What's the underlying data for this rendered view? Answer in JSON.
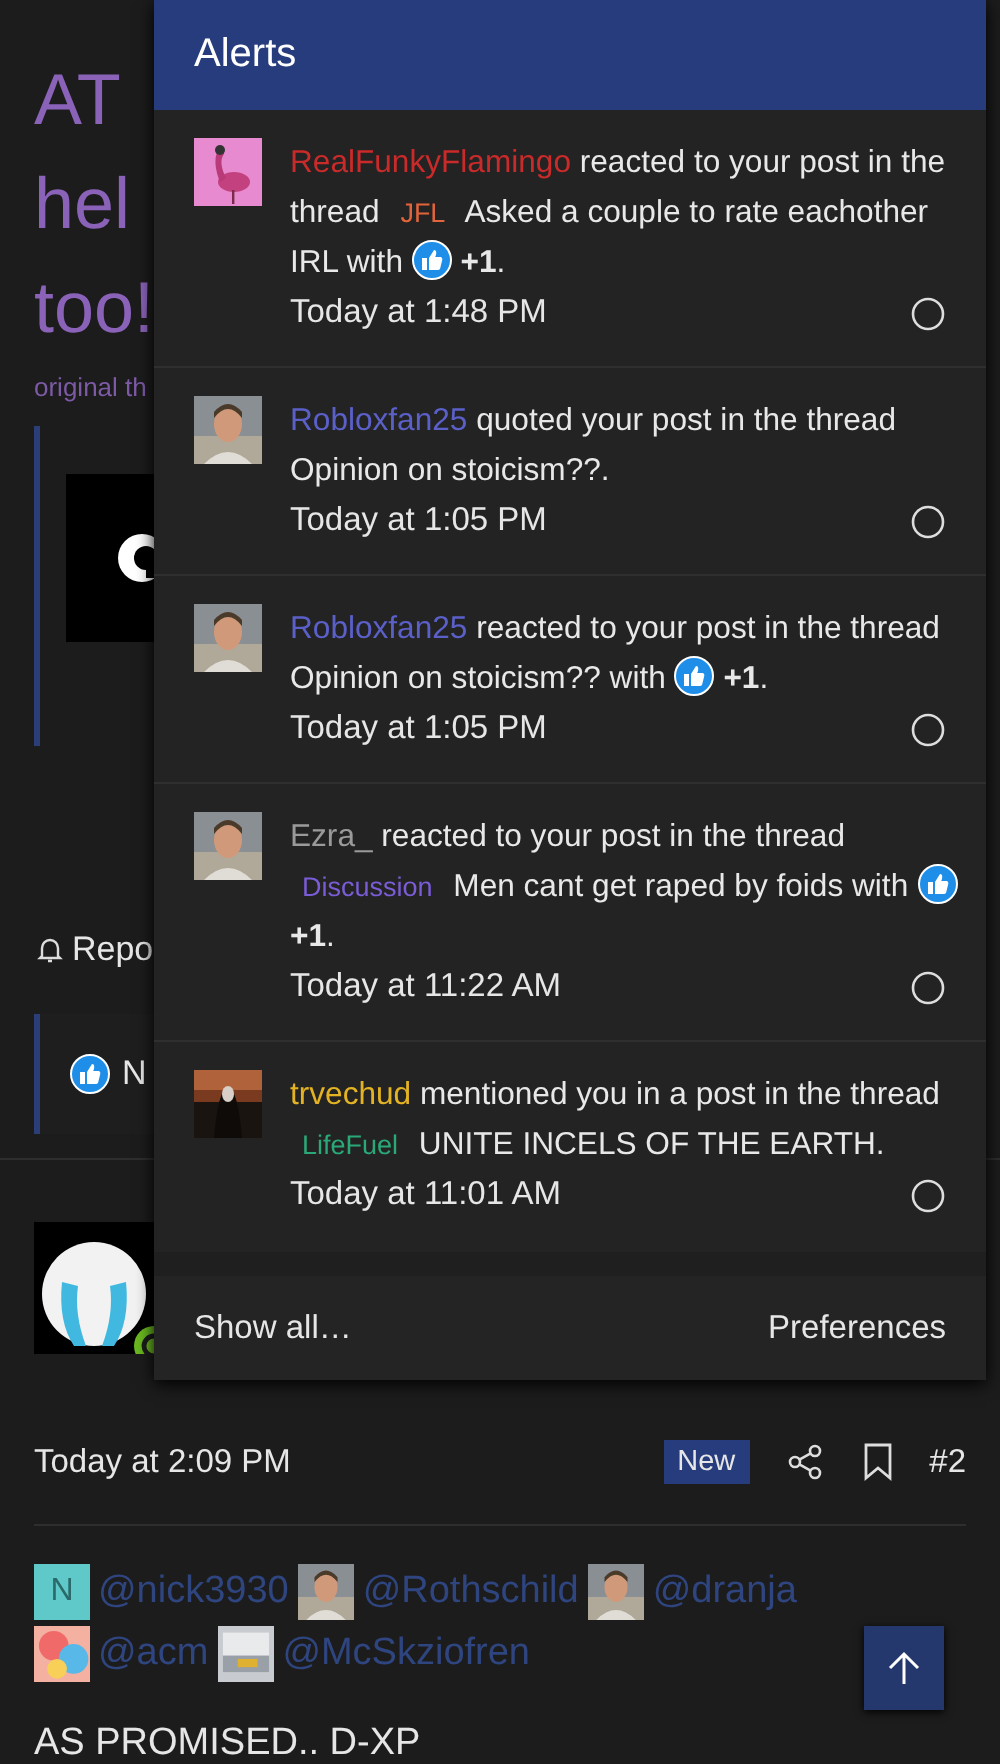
{
  "background_thread": {
    "title_lines": [
      "AT",
      "hel",
      "too!"
    ],
    "source": "original th",
    "report": "Repo",
    "reaction_bar": "N"
  },
  "alerts": {
    "title": "Alerts",
    "items": [
      {
        "user": {
          "name": "RealFunkyFlamingo",
          "color": "#c92a2a"
        },
        "avatar": {
          "kind": "flamingo"
        },
        "action": "reacted to your post in the thread",
        "prefix": {
          "label": "JFL",
          "color": "#e0643c"
        },
        "title": "Asked a couple to rate eachother IRL",
        "reaction": "with",
        "reaction_count": "**+1**.",
        "time": "Today at 1:48 PM",
        "read": false
      },
      {
        "user": {
          "name": "Robloxfan25",
          "color": "#5b60c9"
        },
        "avatar": {
          "kind": "person"
        },
        "action": "quoted your post in the thread",
        "title": "Opinion on stoicism??.",
        "time": "Today at 1:05 PM",
        "read": false
      },
      {
        "user": {
          "name": "Robloxfan25",
          "color": "#5b60c9"
        },
        "avatar": {
          "kind": "person"
        },
        "action": "reacted to your post in the thread",
        "title": "Opinion on stoicism??",
        "reaction": "with",
        "reaction_count": "**+1**.",
        "time": "Today at 1:05 PM",
        "read": false
      },
      {
        "user": {
          "name": "Ezra_",
          "color": "#9a9a9a"
        },
        "avatar": {
          "kind": "person"
        },
        "action": "reacted to your post in the thread",
        "prefix": {
          "label": "Discussion",
          "color": "#7a5cd6"
        },
        "title": "Men cant get raped by foids",
        "reaction": "with",
        "reaction_count": "**+1**.",
        "time": "Today at 11:22 AM",
        "read": false
      },
      {
        "user": {
          "name": "trvechud",
          "color": "#e3b324"
        },
        "avatar": {
          "kind": "dark"
        },
        "action": "mentioned you in a post in the thread",
        "prefix": {
          "label": "LifeFuel",
          "color": "#2aa878"
        },
        "title": "UNITE INCELS OF THE EARTH.",
        "time": "Today at 11:01 AM",
        "read": false
      }
    ],
    "footer": {
      "show_all": "Show all…",
      "preferences": "Preferences"
    }
  },
  "post": {
    "time": "Today at 2:09 PM",
    "badge": "New",
    "number": "#2",
    "mentions": [
      {
        "name": "@nick3930",
        "avatar": {
          "kind": "letter",
          "letter": "N"
        }
      },
      {
        "name": "@Rothschild",
        "avatar": {
          "kind": "person"
        }
      },
      {
        "name": "@dranja",
        "avatar": {
          "kind": "person"
        }
      },
      {
        "name": "@acm",
        "avatar": {
          "kind": "art"
        }
      },
      {
        "name": "@McSkziofren",
        "avatar": {
          "kind": "building"
        }
      }
    ],
    "text": "AS PROMISED.. D-XP"
  }
}
